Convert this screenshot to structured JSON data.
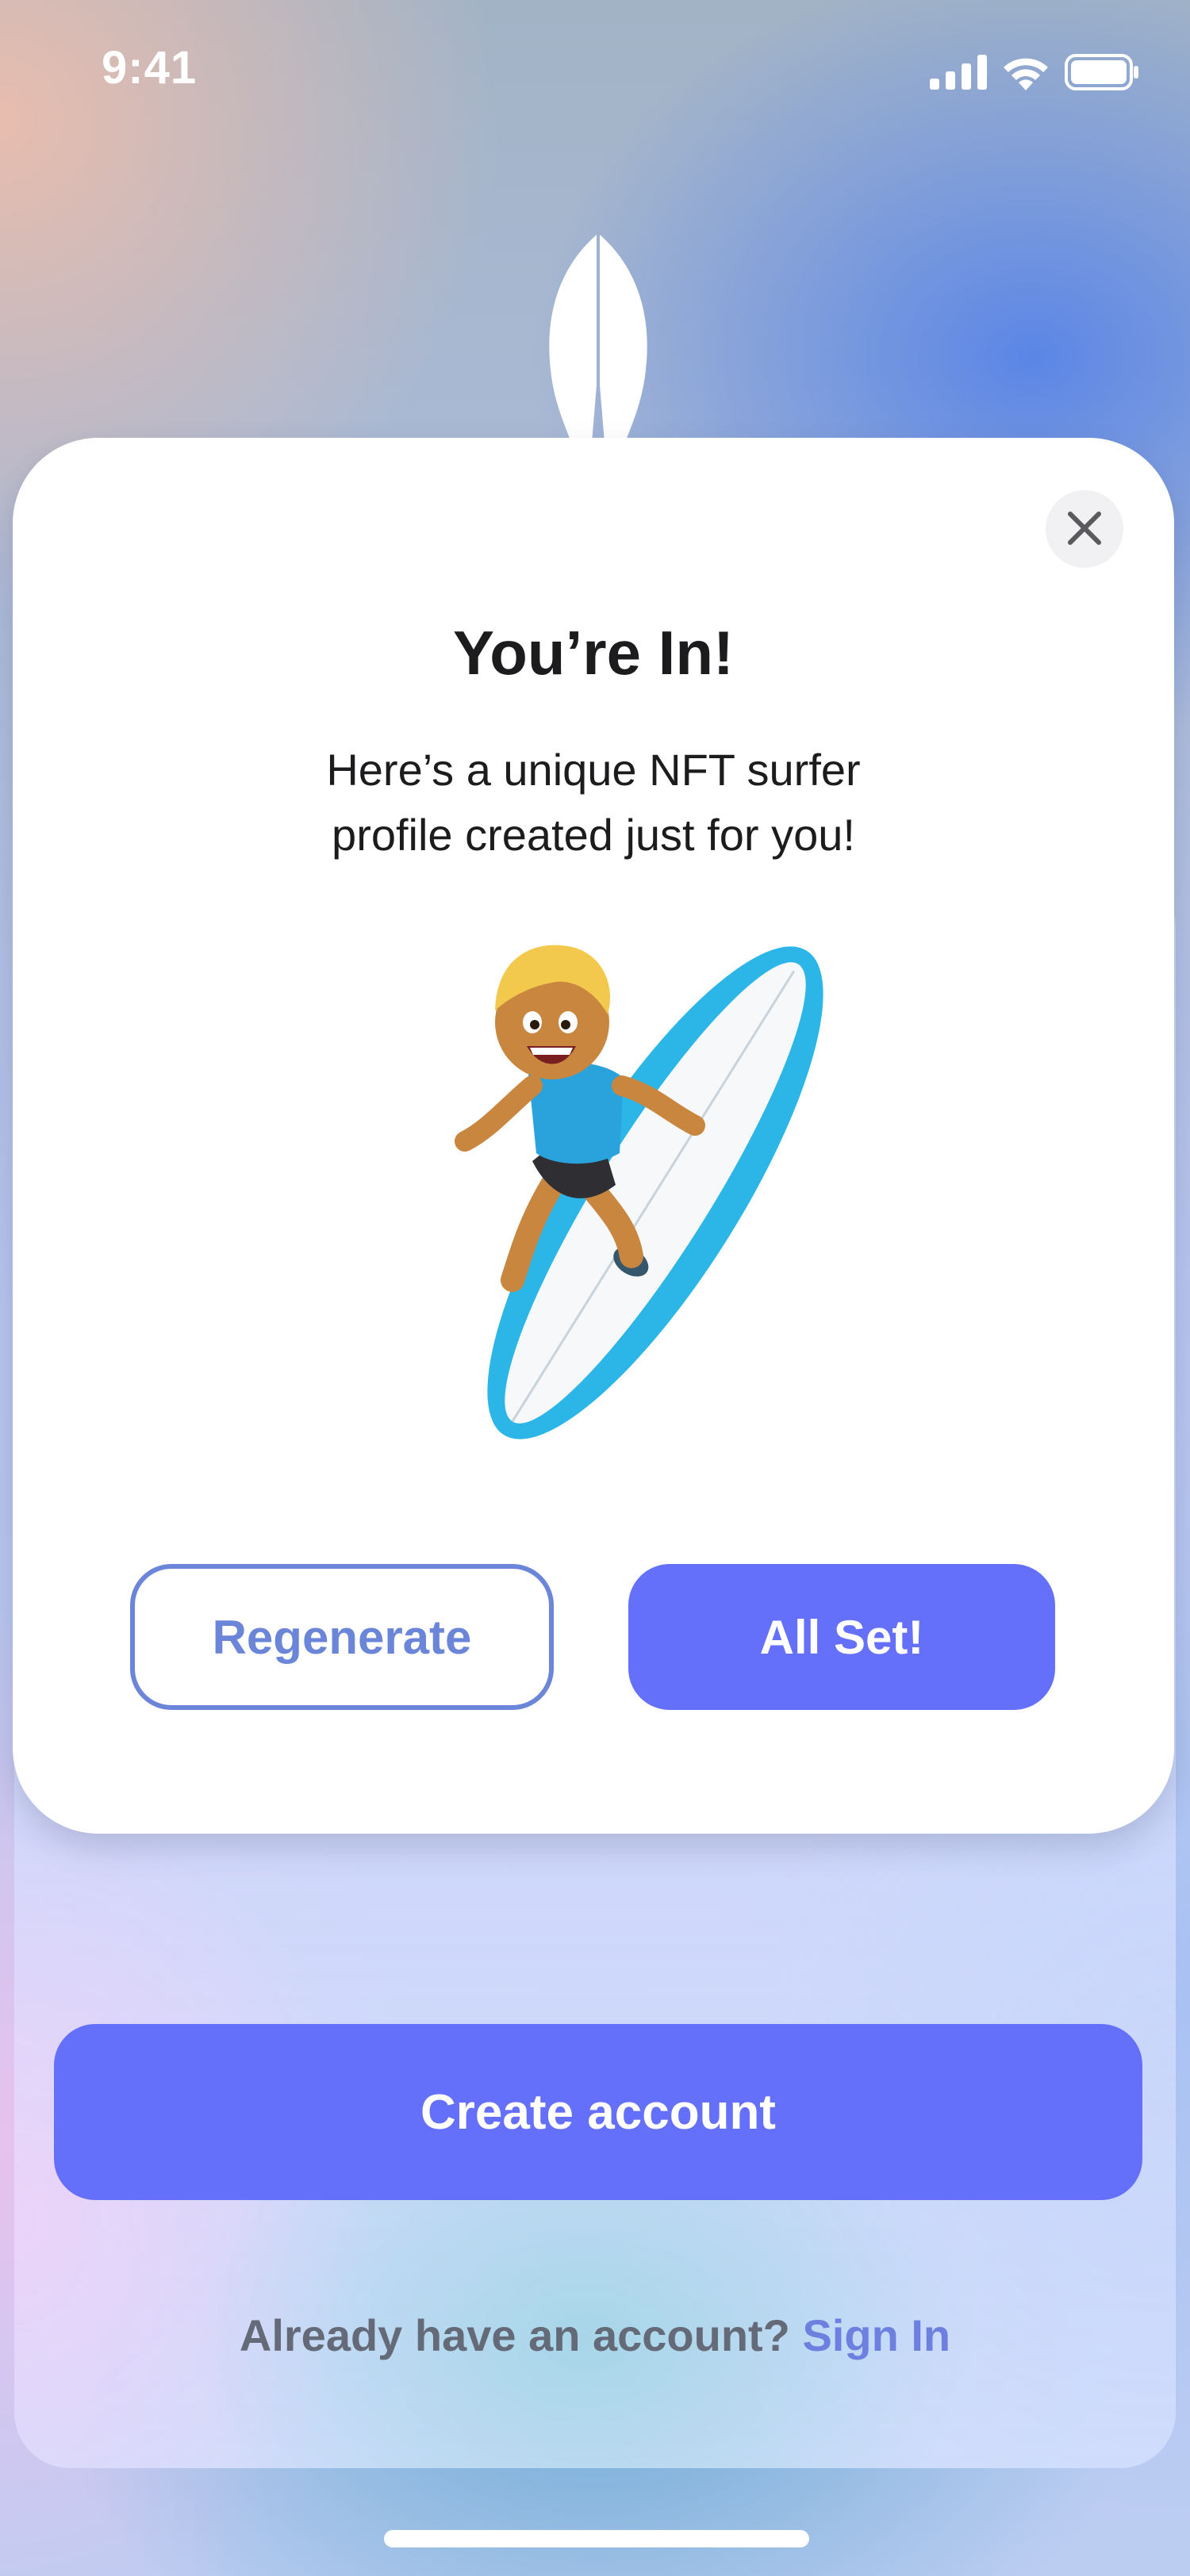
{
  "status_bar": {
    "time": "9:41",
    "icons": [
      "cellular-signal-icon",
      "wifi-icon",
      "battery-icon"
    ]
  },
  "logo": {
    "icon": "surfboard-logo-icon",
    "color": "#ffffff"
  },
  "modal": {
    "title": "You’re In!",
    "subtitle": "Here’s a unique NFT surfer profile created just for you!",
    "image": "surfer-emoji-illustration",
    "close_icon": "close-icon",
    "regenerate_label": "Regenerate",
    "all_set_label": "All Set!"
  },
  "onboarding": {
    "create_account_label": "Create account",
    "signin_prompt": "Already have an account?",
    "signin_link": "Sign In"
  },
  "colors": {
    "primary": "#6470f9",
    "outline": "#6b86d8",
    "link": "#6d80e0",
    "text": "#1c1c1e"
  }
}
